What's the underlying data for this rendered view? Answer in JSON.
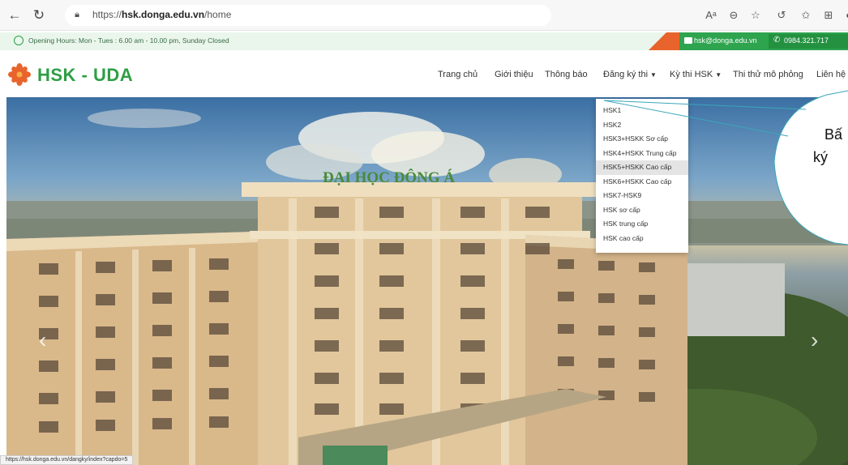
{
  "browser": {
    "back_icon": "arrow-left-icon",
    "reload_icon": "reload-icon",
    "url_prefix": "https://",
    "url_host": "hsk.donga.edu.vn",
    "url_path": "/home",
    "read_aloud": "Aᵃ",
    "status_url": "https://hsk.donga.edu.vn/dangky/index?capdo=5"
  },
  "info_bar": {
    "hours": "Opening Hours: Mon - Tues : 6.00 am - 10.00 pm, Sunday Closed",
    "email": "hsk@donga.edu.vn",
    "phone": "0984.321.717"
  },
  "header": {
    "logo_text": "HSK - UDA",
    "menu": [
      {
        "label": "Trang chủ",
        "has_caret": false
      },
      {
        "label": "Giới thiệu",
        "has_caret": false
      },
      {
        "label": "Thông báo",
        "has_caret": false
      },
      {
        "label": "Đăng ký thi",
        "has_caret": true
      },
      {
        "label": "Kỳ thi HSK",
        "has_caret": true
      },
      {
        "label": "Thi thử mô phỏng",
        "has_caret": false
      },
      {
        "label": "Liên hệ",
        "has_caret": false
      }
    ]
  },
  "hero": {
    "building_sign": "ĐẠI HỌC ĐÔNG Á"
  },
  "dropdown": {
    "items": [
      "HSK1",
      "HSK2",
      "HSK3+HSKK Sơ cấp",
      "HSK4+HSKK Trung cấp",
      "HSK5+HSKK Cao cấp",
      "HSK6+HSKK Cao cấp",
      "HSK7-HSK9",
      "HSK sơ cấp",
      "HSK trung cấp",
      "HSK cao cấp"
    ],
    "active_index": 4
  },
  "callout": {
    "line1": "Bấ",
    "line2": "ký"
  },
  "colors": {
    "brand_green": "#2e9e45",
    "accent_orange": "#e8642c",
    "callout_border": "#3aa6b9"
  }
}
